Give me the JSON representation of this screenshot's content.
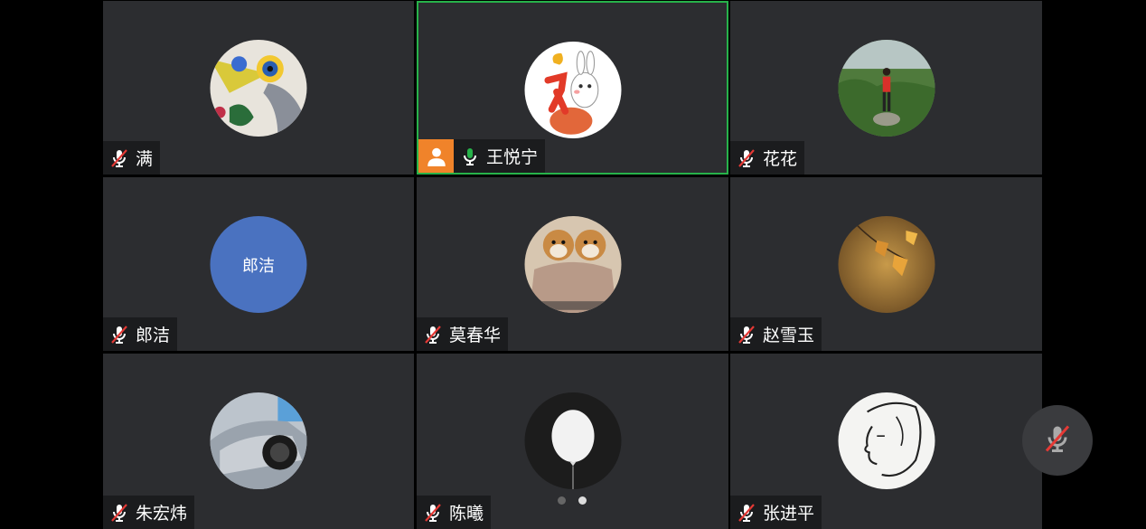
{
  "participants": [
    {
      "name": "满",
      "muted": true
    },
    {
      "name": "王悦宁",
      "muted": false,
      "host": true,
      "speaking": true
    },
    {
      "name": "花花",
      "muted": true
    },
    {
      "name": "郎洁",
      "muted": true,
      "avatar_text": "郎洁"
    },
    {
      "name": "莫春华",
      "muted": true
    },
    {
      "name": "赵雪玉",
      "muted": true
    },
    {
      "name": "朱宏炜",
      "muted": true
    },
    {
      "name": "陈曦",
      "muted": true
    },
    {
      "name": "张进平",
      "muted": true
    }
  ],
  "pagination": {
    "total": 2,
    "current": 2
  },
  "colors": {
    "tile_bg": "#2c2d30",
    "active_border": "#27b24a",
    "host_badge": "#f0832a",
    "muted_red": "#e53935",
    "mic_green": "#27b24a",
    "avatar_blue": "#4a72c0"
  },
  "icons": {
    "muted": "mic-muted-icon",
    "unmuted": "mic-icon",
    "host": "host-person-icon"
  }
}
